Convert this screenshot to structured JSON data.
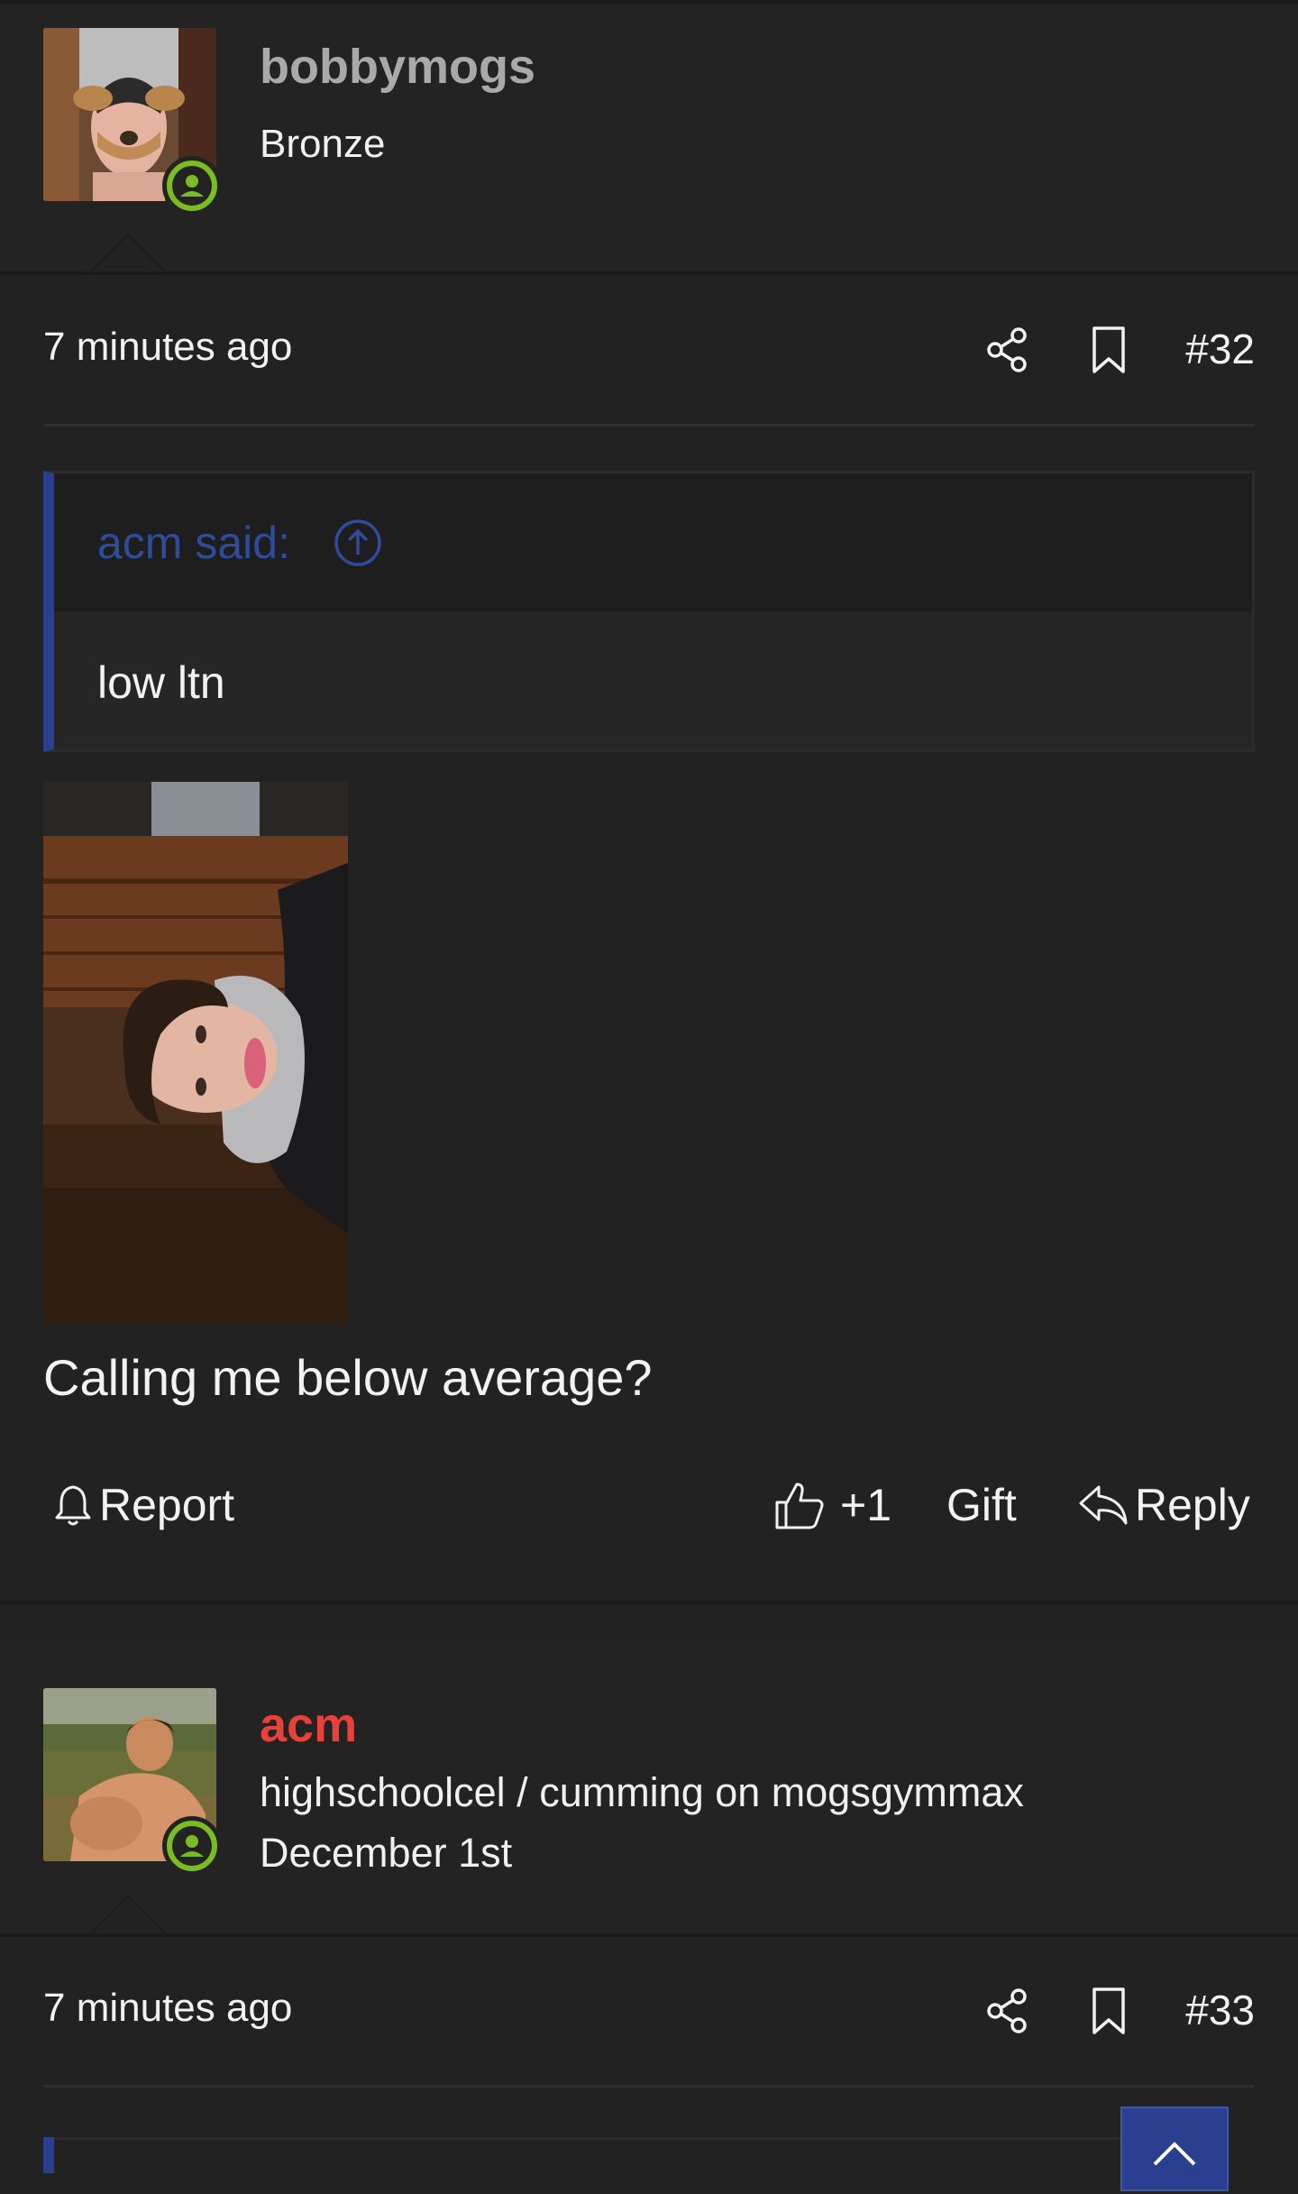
{
  "post1": {
    "username": "bobbymogs",
    "user_title": "Bronze",
    "time": "7 minutes ago",
    "post_number": "#32",
    "quote": {
      "author": "acm said:",
      "text": "low ltn"
    },
    "body_text": "Calling me below average?",
    "actions": {
      "report": "Report",
      "reaction_count": "+1",
      "gift": "Gift",
      "reply": "Reply"
    }
  },
  "post2": {
    "username": "acm",
    "user_title": "highschoolcel / cumming on mogsgymmax",
    "user_date": "December 1st",
    "time": "7 minutes ago",
    "post_number": "#33"
  },
  "colors": {
    "background": "#222222",
    "username_post1": "#a9a9a9",
    "username_post2": "#e8403a",
    "online_status": "#7bbd21",
    "quote_accent": "#2a3f8f"
  },
  "icons": [
    "user-status-icon",
    "share-icon",
    "bookmark-icon",
    "arrow-up-circle-icon",
    "bell-icon",
    "thumbs-up-icon",
    "reply-icon",
    "arrow-up-icon"
  ]
}
